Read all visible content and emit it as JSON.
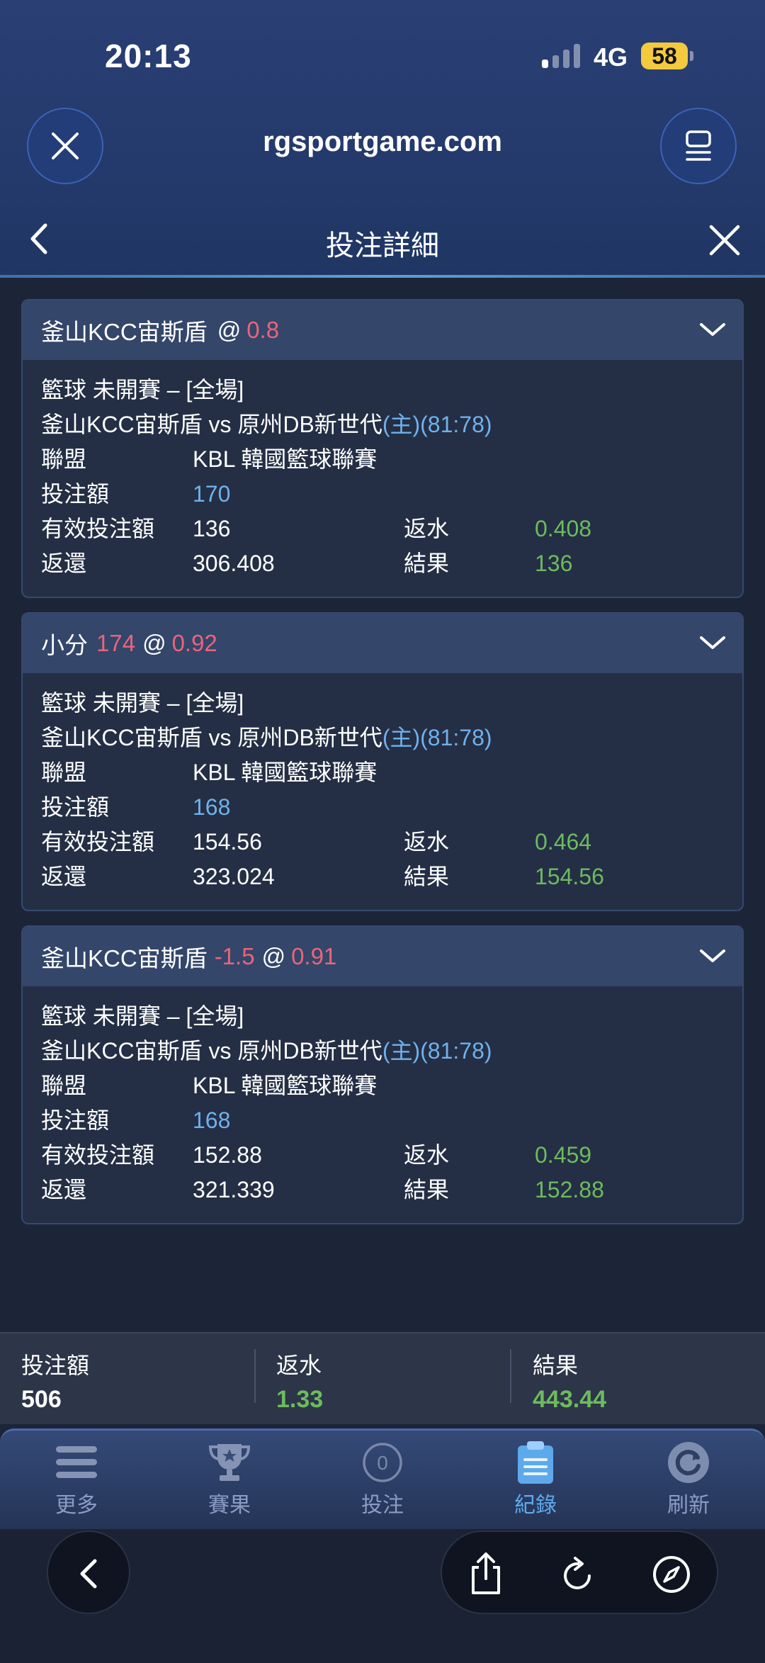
{
  "status_bar": {
    "time": "20:13",
    "network": "4G",
    "battery": "58"
  },
  "browser": {
    "url": "rgsportgame.com"
  },
  "page": {
    "title": "投注詳細"
  },
  "labels": {
    "league": "聯盟",
    "stake": "投注額",
    "valid_stake": "有效投注額",
    "rebate": "返水",
    "return": "返還",
    "result": "結果"
  },
  "bets": [
    {
      "selection": "釜山KCC宙斯盾",
      "handicap": "",
      "at": "@",
      "odds": "0.8",
      "sport_line": "籃球 未開賽 – [全場]",
      "match": "釜山KCC宙斯盾 vs 原州DB新世代",
      "match_suffix": "(主)(81:78)",
      "league": "KBL 韓國籃球聯賽",
      "stake": "170",
      "valid_stake": "136",
      "rebate": "0.408",
      "return": "306.408",
      "result": "136"
    },
    {
      "selection": "小分",
      "handicap": "174",
      "at": "@",
      "odds": "0.92",
      "sport_line": "籃球 未開賽 – [全場]",
      "match": "釜山KCC宙斯盾 vs 原州DB新世代",
      "match_suffix": "(主)(81:78)",
      "league": "KBL 韓國籃球聯賽",
      "stake": "168",
      "valid_stake": "154.56",
      "rebate": "0.464",
      "return": "323.024",
      "result": "154.56"
    },
    {
      "selection": "釜山KCC宙斯盾",
      "handicap": "-1.5",
      "at": "@",
      "odds": "0.91",
      "sport_line": "籃球 未開賽 – [全場]",
      "match": "釜山KCC宙斯盾 vs 原州DB新世代",
      "match_suffix": "(主)(81:78)",
      "league": "KBL 韓國籃球聯賽",
      "stake": "168",
      "valid_stake": "152.88",
      "rebate": "0.459",
      "return": "321.339",
      "result": "152.88"
    }
  ],
  "summary": {
    "stake_label": "投注額",
    "stake_value": "506",
    "rebate_label": "返水",
    "rebate_value": "1.33",
    "result_label": "結果",
    "result_value": "443.44"
  },
  "tabs": [
    {
      "label": "更多",
      "icon": "menu-icon",
      "active": false
    },
    {
      "label": "賽果",
      "icon": "trophy-icon",
      "active": false
    },
    {
      "label": "投注",
      "icon": "bet-count-icon",
      "badge": "0",
      "active": false
    },
    {
      "label": "紀錄",
      "icon": "clipboard-icon",
      "active": true
    },
    {
      "label": "刷新",
      "icon": "refresh-icon",
      "active": false
    }
  ],
  "colors": {
    "odds": "#e9657b",
    "amount": "#6fb1ec",
    "positive": "#6dbb5e",
    "active_tab": "#5ea9ec"
  }
}
